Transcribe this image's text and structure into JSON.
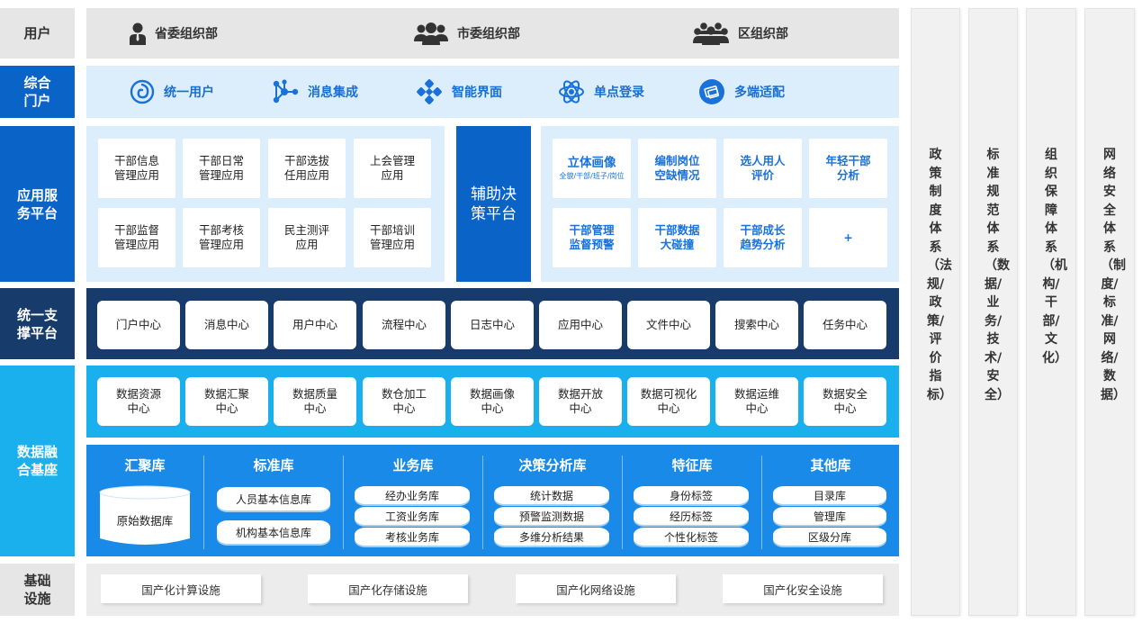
{
  "layers": {
    "user": "用户",
    "portal": "综合\n门户",
    "app": "应用服\n务平台",
    "support": "统一支\n撑平台",
    "data": "数据融\n合基座",
    "infra": "基础\n设施"
  },
  "users": [
    {
      "label": "省委组织部",
      "icon": "single-person-icon"
    },
    {
      "label": "市委组织部",
      "icon": "group-three-icon"
    },
    {
      "label": "区组织部",
      "icon": "group-many-icon"
    }
  ],
  "portal": [
    {
      "label": "统一用户",
      "icon": "spiral-icon"
    },
    {
      "label": "消息集成",
      "icon": "network-node-icon"
    },
    {
      "label": "智能界面",
      "icon": "diamond-grid-icon"
    },
    {
      "label": "单点登录",
      "icon": "atom-icon"
    },
    {
      "label": "多端适配",
      "icon": "devices-icon"
    }
  ],
  "apps": [
    "干部信息\n管理应用",
    "干部日常\n管理应用",
    "干部选拔\n任用应用",
    "上会管理\n应用",
    "干部监督\n管理应用",
    "干部考核\n管理应用",
    "民主测评\n应用",
    "干部培训\n管理应用"
  ],
  "decision_platform": "辅助决\n策平台",
  "decision": {
    "portrait_title": "立体画像",
    "portrait_sub": "全貌/干部/班子/岗位",
    "items": [
      "编制岗位\n空缺情况",
      "选人用人\n评价",
      "年轻干部\n分析",
      "干部管理\n监督预警",
      "干部数据\n大碰撞",
      "干部成长\n趋势分析",
      "+"
    ]
  },
  "support": [
    "门户中心",
    "消息中心",
    "用户中心",
    "流程中心",
    "日志中心",
    "应用中心",
    "文件中心",
    "搜索中心",
    "任务中心"
  ],
  "data_centers": [
    "数据资源\n中心",
    "数据汇聚\n中心",
    "数据质量\n中心",
    "数仓加工\n中心",
    "数据画像\n中心",
    "数据开放\n中心",
    "数据可视化\n中心",
    "数据运维\n中心",
    "数据安全\n中心"
  ],
  "databases": [
    {
      "title": "汇聚库",
      "items": [
        "原始数据库"
      ]
    },
    {
      "title": "标准库",
      "items": [
        "人员基本信息库",
        "机构基本信息库"
      ]
    },
    {
      "title": "业务库",
      "items": [
        "经办业务库",
        "工资业务库",
        "考核业务库"
      ]
    },
    {
      "title": "决策分析库",
      "items": [
        "统计数据",
        "预警监测数据",
        "多维分析结果"
      ]
    },
    {
      "title": "特征库",
      "items": [
        "身份标签",
        "经历标签",
        "个性化标签"
      ]
    },
    {
      "title": "其他库",
      "items": [
        "目录库",
        "管理库",
        "区级分库"
      ]
    }
  ],
  "infra": [
    "国产化计算设施",
    "国产化存储设施",
    "国产化网络设施",
    "国产化安全设施"
  ],
  "systems": [
    "政策制度体系（法规/政策/评价指标）",
    "标准规范体系（数据/业务/技术/安全）",
    "组织保障体系（机构/干部/文化）",
    "网络安全体系（制度/标准/网络/数据）"
  ],
  "colors": {
    "dark_blue": "#0a63c6",
    "navy": "#173b6b",
    "sky": "#1ab0ee",
    "bright_blue": "#1a8ae8",
    "light_panel": "#dceefc",
    "gray": "#e6e6e6"
  }
}
